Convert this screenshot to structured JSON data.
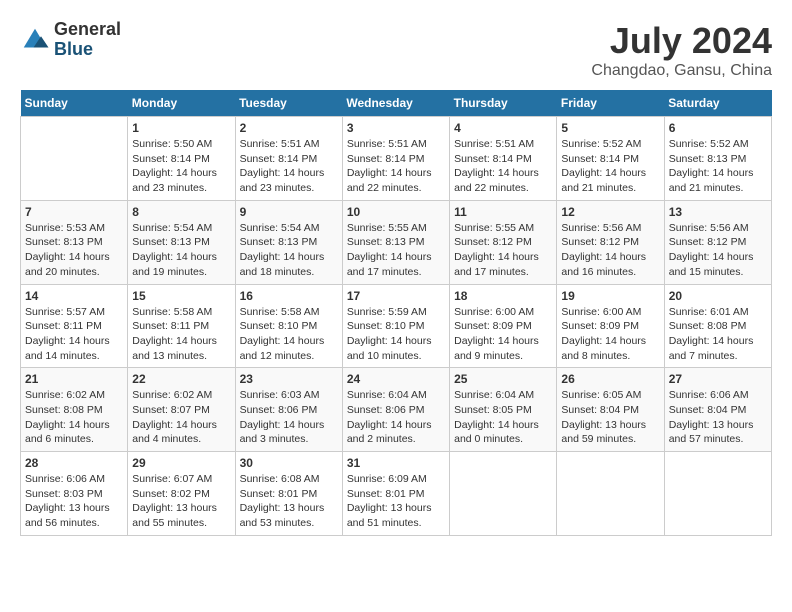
{
  "header": {
    "logo_general": "General",
    "logo_blue": "Blue",
    "month_year": "July 2024",
    "location": "Changdao, Gansu, China"
  },
  "calendar": {
    "weekdays": [
      "Sunday",
      "Monday",
      "Tuesday",
      "Wednesday",
      "Thursday",
      "Friday",
      "Saturday"
    ],
    "weeks": [
      [
        {
          "day": "",
          "info": ""
        },
        {
          "day": "1",
          "info": "Sunrise: 5:50 AM\nSunset: 8:14 PM\nDaylight: 14 hours\nand 23 minutes."
        },
        {
          "day": "2",
          "info": "Sunrise: 5:51 AM\nSunset: 8:14 PM\nDaylight: 14 hours\nand 23 minutes."
        },
        {
          "day": "3",
          "info": "Sunrise: 5:51 AM\nSunset: 8:14 PM\nDaylight: 14 hours\nand 22 minutes."
        },
        {
          "day": "4",
          "info": "Sunrise: 5:51 AM\nSunset: 8:14 PM\nDaylight: 14 hours\nand 22 minutes."
        },
        {
          "day": "5",
          "info": "Sunrise: 5:52 AM\nSunset: 8:14 PM\nDaylight: 14 hours\nand 21 minutes."
        },
        {
          "day": "6",
          "info": "Sunrise: 5:52 AM\nSunset: 8:13 PM\nDaylight: 14 hours\nand 21 minutes."
        }
      ],
      [
        {
          "day": "7",
          "info": "Sunrise: 5:53 AM\nSunset: 8:13 PM\nDaylight: 14 hours\nand 20 minutes."
        },
        {
          "day": "8",
          "info": "Sunrise: 5:54 AM\nSunset: 8:13 PM\nDaylight: 14 hours\nand 19 minutes."
        },
        {
          "day": "9",
          "info": "Sunrise: 5:54 AM\nSunset: 8:13 PM\nDaylight: 14 hours\nand 18 minutes."
        },
        {
          "day": "10",
          "info": "Sunrise: 5:55 AM\nSunset: 8:13 PM\nDaylight: 14 hours\nand 17 minutes."
        },
        {
          "day": "11",
          "info": "Sunrise: 5:55 AM\nSunset: 8:12 PM\nDaylight: 14 hours\nand 17 minutes."
        },
        {
          "day": "12",
          "info": "Sunrise: 5:56 AM\nSunset: 8:12 PM\nDaylight: 14 hours\nand 16 minutes."
        },
        {
          "day": "13",
          "info": "Sunrise: 5:56 AM\nSunset: 8:12 PM\nDaylight: 14 hours\nand 15 minutes."
        }
      ],
      [
        {
          "day": "14",
          "info": "Sunrise: 5:57 AM\nSunset: 8:11 PM\nDaylight: 14 hours\nand 14 minutes."
        },
        {
          "day": "15",
          "info": "Sunrise: 5:58 AM\nSunset: 8:11 PM\nDaylight: 14 hours\nand 13 minutes."
        },
        {
          "day": "16",
          "info": "Sunrise: 5:58 AM\nSunset: 8:10 PM\nDaylight: 14 hours\nand 12 minutes."
        },
        {
          "day": "17",
          "info": "Sunrise: 5:59 AM\nSunset: 8:10 PM\nDaylight: 14 hours\nand 10 minutes."
        },
        {
          "day": "18",
          "info": "Sunrise: 6:00 AM\nSunset: 8:09 PM\nDaylight: 14 hours\nand 9 minutes."
        },
        {
          "day": "19",
          "info": "Sunrise: 6:00 AM\nSunset: 8:09 PM\nDaylight: 14 hours\nand 8 minutes."
        },
        {
          "day": "20",
          "info": "Sunrise: 6:01 AM\nSunset: 8:08 PM\nDaylight: 14 hours\nand 7 minutes."
        }
      ],
      [
        {
          "day": "21",
          "info": "Sunrise: 6:02 AM\nSunset: 8:08 PM\nDaylight: 14 hours\nand 6 minutes."
        },
        {
          "day": "22",
          "info": "Sunrise: 6:02 AM\nSunset: 8:07 PM\nDaylight: 14 hours\nand 4 minutes."
        },
        {
          "day": "23",
          "info": "Sunrise: 6:03 AM\nSunset: 8:06 PM\nDaylight: 14 hours\nand 3 minutes."
        },
        {
          "day": "24",
          "info": "Sunrise: 6:04 AM\nSunset: 8:06 PM\nDaylight: 14 hours\nand 2 minutes."
        },
        {
          "day": "25",
          "info": "Sunrise: 6:04 AM\nSunset: 8:05 PM\nDaylight: 14 hours\nand 0 minutes."
        },
        {
          "day": "26",
          "info": "Sunrise: 6:05 AM\nSunset: 8:04 PM\nDaylight: 13 hours\nand 59 minutes."
        },
        {
          "day": "27",
          "info": "Sunrise: 6:06 AM\nSunset: 8:04 PM\nDaylight: 13 hours\nand 57 minutes."
        }
      ],
      [
        {
          "day": "28",
          "info": "Sunrise: 6:06 AM\nSunset: 8:03 PM\nDaylight: 13 hours\nand 56 minutes."
        },
        {
          "day": "29",
          "info": "Sunrise: 6:07 AM\nSunset: 8:02 PM\nDaylight: 13 hours\nand 55 minutes."
        },
        {
          "day": "30",
          "info": "Sunrise: 6:08 AM\nSunset: 8:01 PM\nDaylight: 13 hours\nand 53 minutes."
        },
        {
          "day": "31",
          "info": "Sunrise: 6:09 AM\nSunset: 8:01 PM\nDaylight: 13 hours\nand 51 minutes."
        },
        {
          "day": "",
          "info": ""
        },
        {
          "day": "",
          "info": ""
        },
        {
          "day": "",
          "info": ""
        }
      ]
    ]
  }
}
